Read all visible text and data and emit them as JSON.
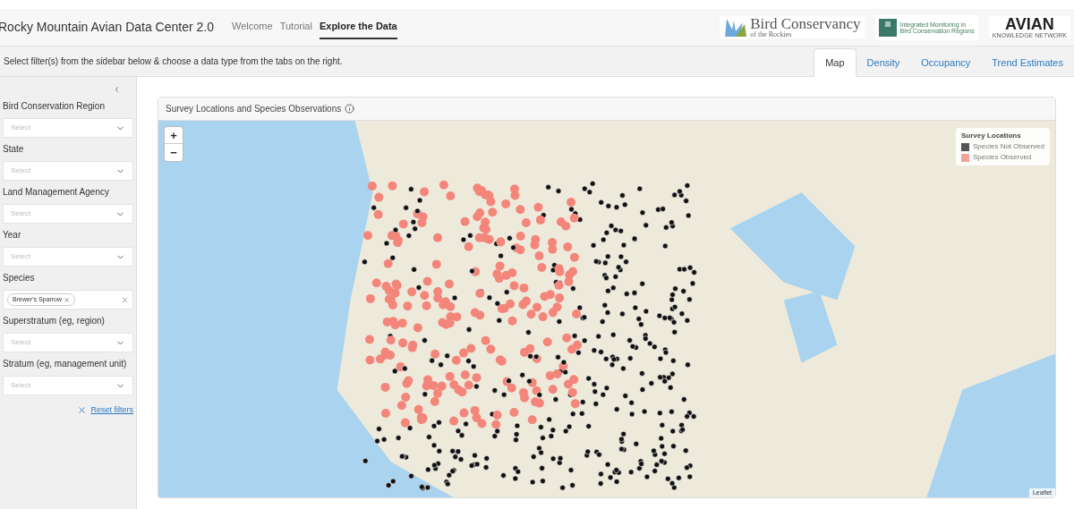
{
  "header": {
    "title": "Rocky Mountain Avian Data Center 2.0",
    "nav": [
      {
        "label": "Welcome",
        "selected": false
      },
      {
        "label": "Tutorial",
        "selected": false
      },
      {
        "label": "Explore the Data",
        "selected": true
      }
    ],
    "logos": [
      {
        "kind": "bcr",
        "title": "Bird Conservancy",
        "subtitle": "of the Rockies"
      },
      {
        "kind": "imbcr",
        "title": "Integrated Monitoring in",
        "subtitle": "Bird Conservation Regions"
      },
      {
        "kind": "akn",
        "title": "AVIAN",
        "subtitle": "KNOWLEDGE NETWORK"
      }
    ]
  },
  "instructions": "Select filter(s) from the sidebar below & choose a data type from the tabs on the right.",
  "tabs": [
    {
      "label": "Map",
      "selected": true
    },
    {
      "label": "Density",
      "selected": false
    },
    {
      "label": "Occupancy",
      "selected": false
    },
    {
      "label": "Trend Estimates",
      "selected": false
    }
  ],
  "sidebar": {
    "collapse": "‹",
    "filters": [
      {
        "label": "Bird Conservation Region",
        "placeholder": "Select"
      },
      {
        "label": "State",
        "placeholder": "Select"
      },
      {
        "label": "Land Management Agency",
        "placeholder": "Select"
      },
      {
        "label": "Year",
        "placeholder": "Select"
      },
      {
        "label": "Species",
        "chips": [
          "Brewer's Sparrow"
        ]
      },
      {
        "label": "Superstratum (eg, region)",
        "placeholder": "Select"
      },
      {
        "label": "Stratum (eg, management unit)",
        "placeholder": "Select"
      }
    ],
    "reset": "Reset filters"
  },
  "map_panel": {
    "title": "Survey Locations and Species Observations",
    "zoom_in": "+",
    "zoom_out": "−",
    "legend": {
      "title": "Survey Locations",
      "items": [
        {
          "label": "Species Not Observed",
          "color": "#555555"
        },
        {
          "label": "Species Observed",
          "color": "#f4a19a"
        }
      ]
    },
    "attribution": "Leaflet"
  }
}
